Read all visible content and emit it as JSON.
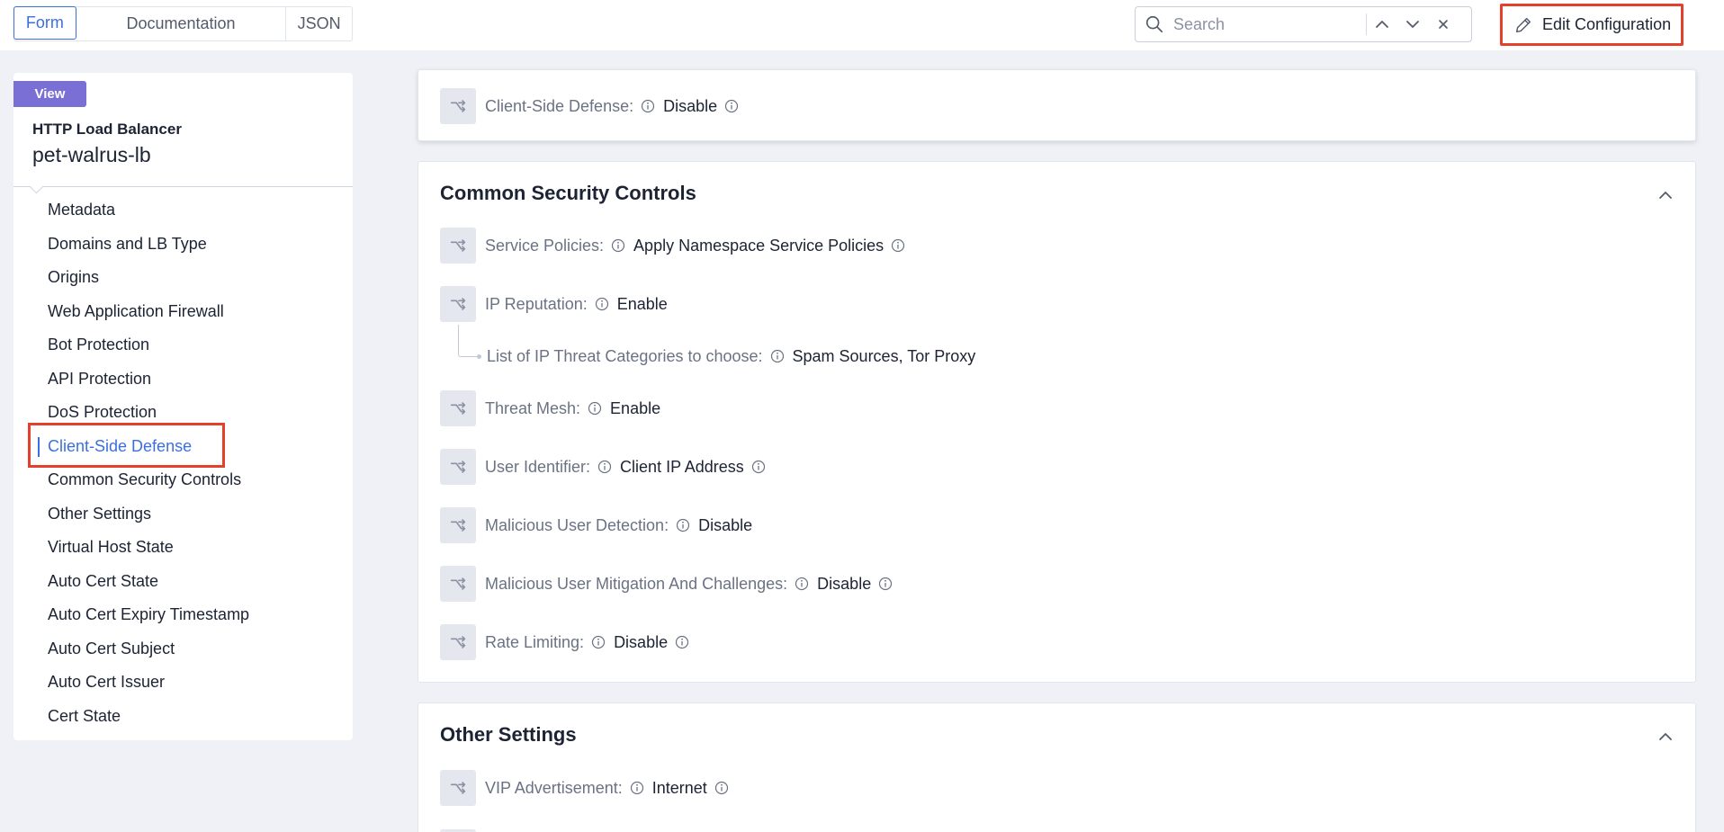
{
  "view_tabs": [
    "Form",
    "Documentation",
    "JSON"
  ],
  "search": {
    "placeholder": "Search"
  },
  "edit_button": {
    "label": "Edit Configuration"
  },
  "sidebar": {
    "badge": "View",
    "object_type": "HTTP Load Balancer",
    "object_name": "pet-walrus-lb",
    "active_item": "Client-Side Defense",
    "items": [
      "Metadata",
      "Domains and LB Type",
      "Origins",
      "Web Application Firewall",
      "Bot Protection",
      "API Protection",
      "DoS Protection",
      "Client-Side Defense",
      "Common Security Controls",
      "Other Settings",
      "Virtual Host State",
      "Auto Cert State",
      "Auto Cert Expiry Timestamp",
      "Auto Cert Subject",
      "Auto Cert Issuer",
      "Cert State"
    ]
  },
  "client_side_defense": {
    "label": "Client-Side Defense:",
    "value": "Disable"
  },
  "common_security_controls": {
    "title": "Common Security Controls",
    "service_policies": {
      "label": "Service Policies:",
      "value": "Apply Namespace Service Policies"
    },
    "ip_reputation": {
      "label": "IP Reputation:",
      "value": "Enable"
    },
    "ip_threat_categories": {
      "label": "List of IP Threat Categories to choose:",
      "value": "Spam Sources, Tor Proxy"
    },
    "threat_mesh": {
      "label": "Threat Mesh:",
      "value": "Enable"
    },
    "user_identifier": {
      "label": "User Identifier:",
      "value": "Client IP Address"
    },
    "malicious_user_detection": {
      "label": "Malicious User Detection:",
      "value": "Disable"
    },
    "malicious_user_mitigation": {
      "label": "Malicious User Mitigation And Challenges:",
      "value": "Disable"
    },
    "rate_limiting": {
      "label": "Rate Limiting:",
      "value": "Disable"
    }
  },
  "other_settings": {
    "title": "Other Settings",
    "vip_advertisement": {
      "label": "VIP Advertisement:",
      "value": "Internet"
    }
  },
  "icons": {
    "field": "choice-icon",
    "info": "info-icon",
    "collapse": "chevron-up-icon"
  },
  "colors": {
    "accent": "#3b6fe0",
    "badge": "#7a6fd4",
    "highlight": "#e3412b"
  }
}
